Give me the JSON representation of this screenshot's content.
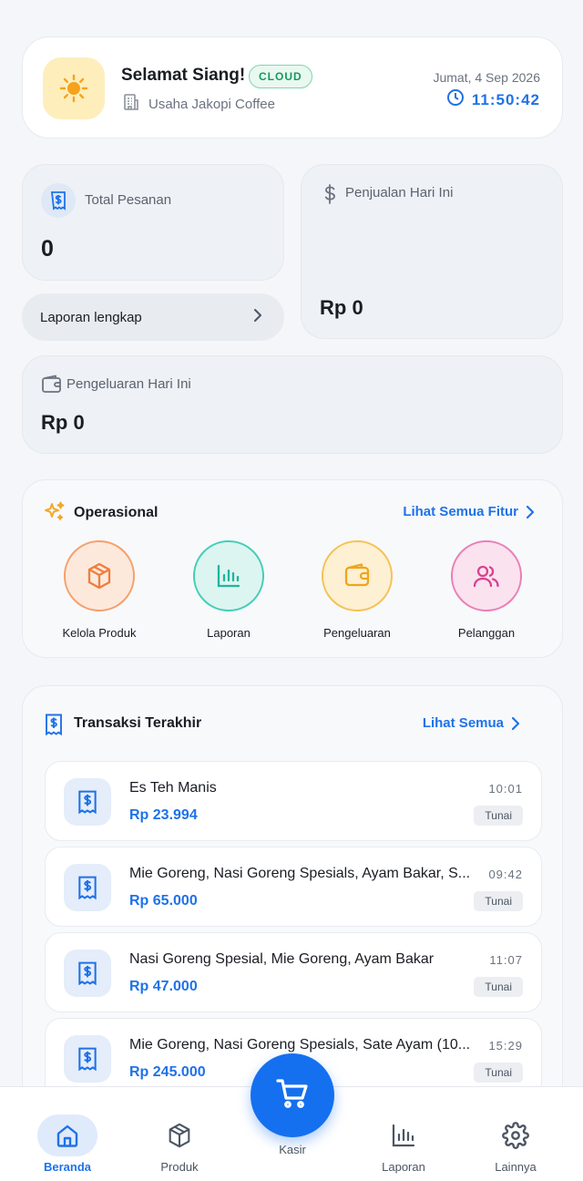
{
  "header": {
    "greeting": "Selamat Siang!",
    "badge": "CLOUD",
    "business_name": "Usaha Jakopi Coffee",
    "date": "Jumat, 4 Sep 2026",
    "time": "11:50:42",
    "weather_icon": "sun-icon"
  },
  "stats": {
    "total_orders_label": "Total Pesanan",
    "total_orders_value": "0",
    "sales_label": "Penjualan Hari Ini",
    "sales_value": "Rp 0",
    "expense_label": "Pengeluaran Hari Ini",
    "expense_value": "Rp 0",
    "report_link": "Laporan lengkap"
  },
  "operasional": {
    "title": "Operasional",
    "see_all": "Lihat Semua Fitur",
    "items": [
      {
        "label": "Kelola Produk",
        "icon": "box-icon",
        "color": "#f08a4b"
      },
      {
        "label": "Laporan",
        "icon": "bar-chart-icon",
        "color": "#2bbfa8"
      },
      {
        "label": "Pengeluaran",
        "icon": "wallet-icon",
        "color": "#f4b135"
      },
      {
        "label": "Pelanggan",
        "icon": "users-icon",
        "color": "#e0529b"
      }
    ]
  },
  "transactions": {
    "title": "Transaksi Terakhir",
    "see_all": "Lihat Semua",
    "items": [
      {
        "name": "Es Teh Manis",
        "amount": "Rp 23.994",
        "time": "10:01",
        "method": "Tunai"
      },
      {
        "name": "Mie Goreng, Nasi Goreng Spesials, Ayam Bakar, S...",
        "amount": "Rp 65.000",
        "time": "09:42",
        "method": "Tunai"
      },
      {
        "name": "Nasi Goreng Spesial, Mie Goreng, Ayam Bakar",
        "amount": "Rp 47.000",
        "time": "11:07",
        "method": "Tunai"
      },
      {
        "name": "Mie Goreng, Nasi Goreng Spesials, Sate Ayam (10...",
        "amount": "Rp 245.000",
        "time": "15:29",
        "method": "Tunai"
      }
    ]
  },
  "nav": {
    "home": "Beranda",
    "products": "Produk",
    "cashier": "Kasir",
    "reports": "Laporan",
    "more": "Lainnya"
  },
  "colors": {
    "accent": "#1f72e8",
    "cloud_badge": "#159a5c"
  }
}
